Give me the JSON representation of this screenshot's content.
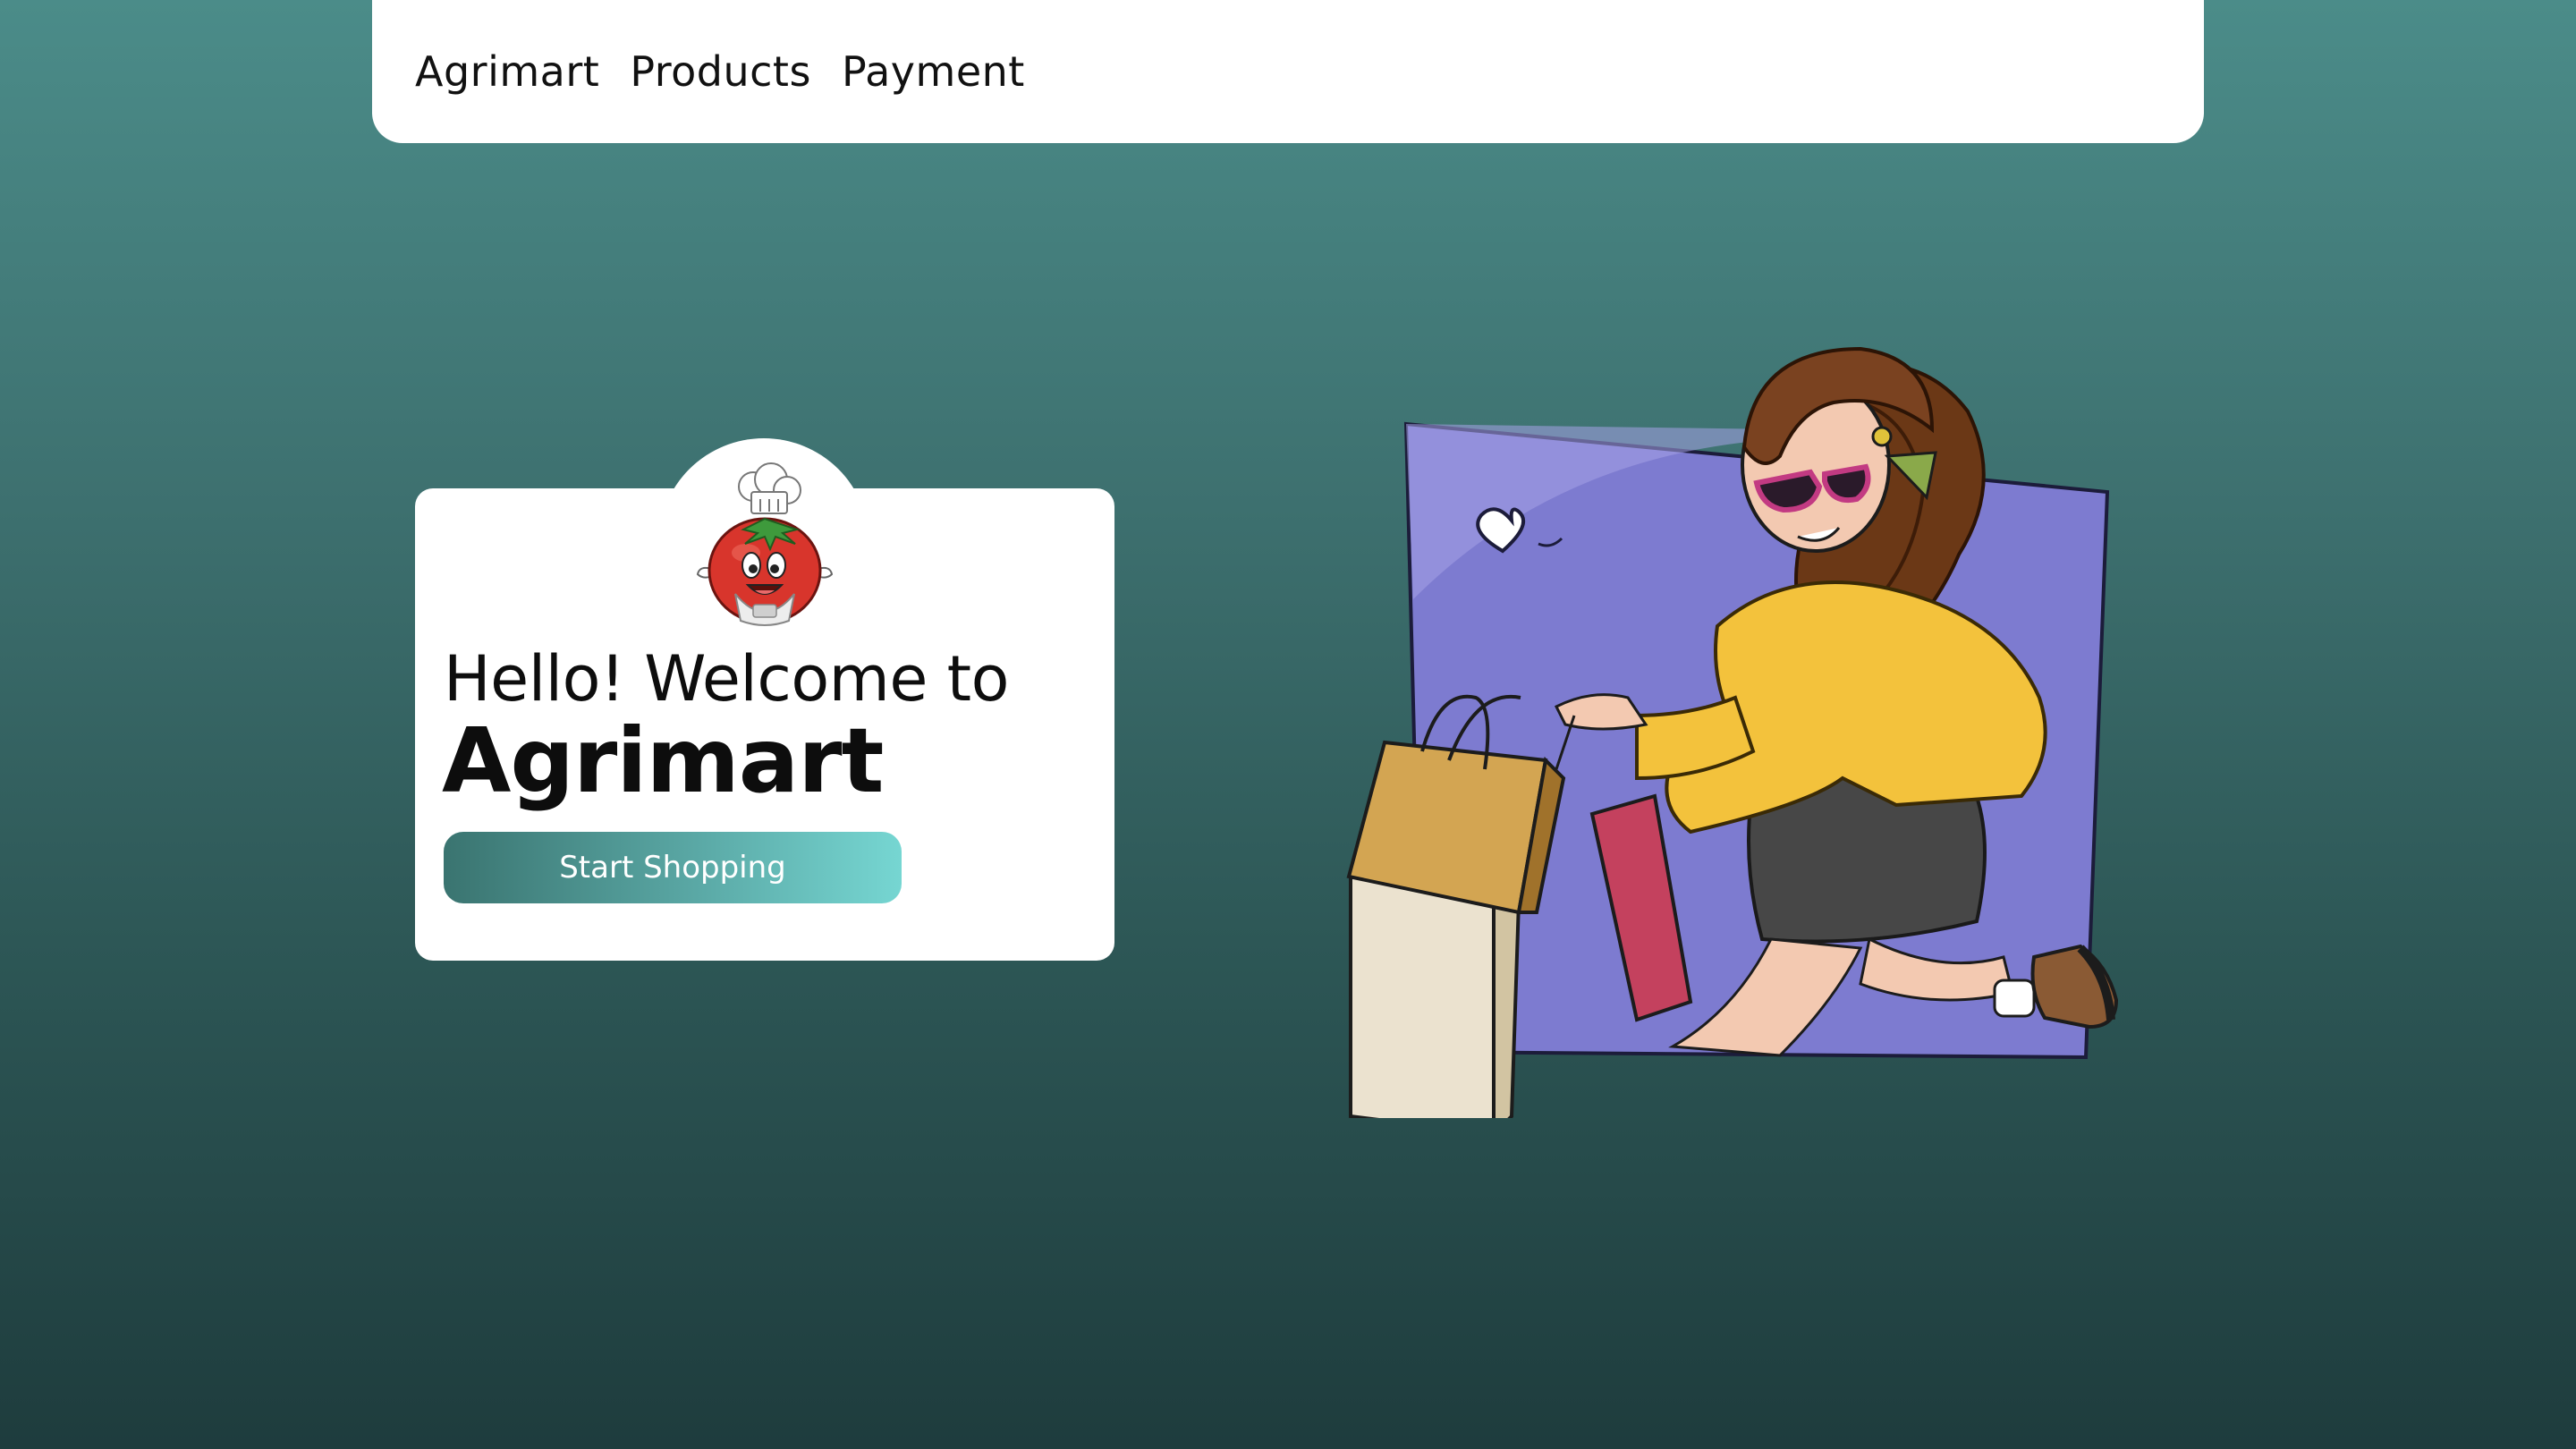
{
  "nav": {
    "brand": "Agrimart",
    "links": [
      "Products",
      "Payment"
    ]
  },
  "hero": {
    "greeting": "Hello! Welcome to",
    "brand": "Agrimart",
    "cta_label": "Start Shopping"
  },
  "icons": {
    "mascot": "tomato-chef-mascot-icon",
    "illustration": "shopping-girl-illustration"
  },
  "colors": {
    "background_top": "#4b8c89",
    "background_bottom": "#1e3c3d",
    "card": "#ffffff",
    "cta_gradient_start": "#3a7470",
    "cta_gradient_end": "#76d6d2"
  }
}
